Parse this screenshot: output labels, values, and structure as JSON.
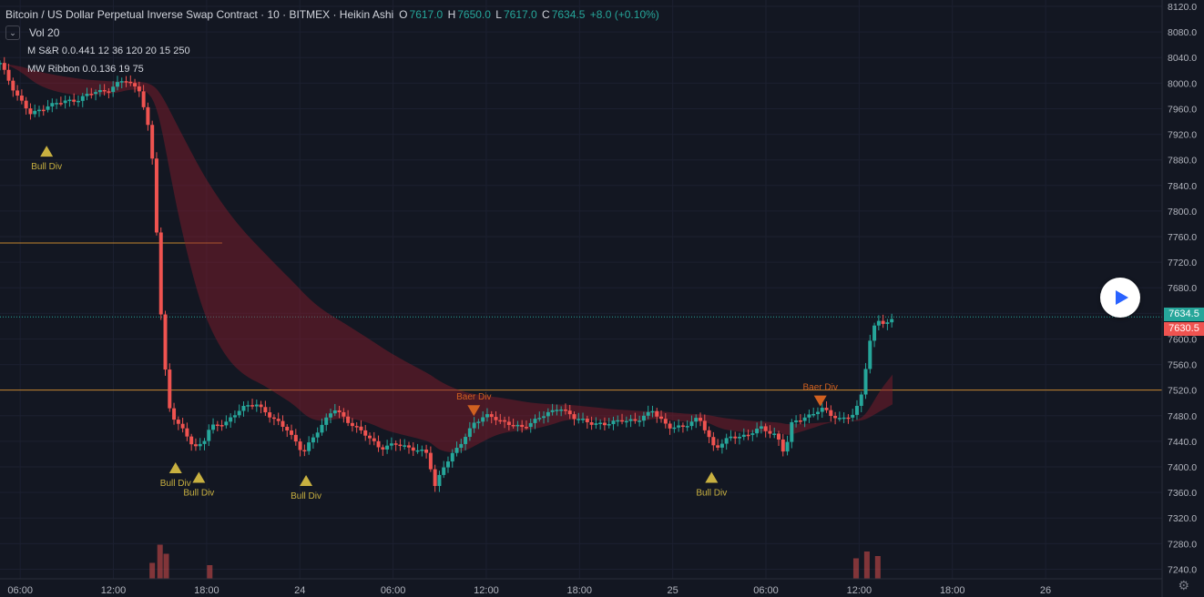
{
  "header": {
    "symbol_title": "Bitcoin / US Dollar Perpetual Inverse Swap Contract · 10 · BITMEX · Heikin Ashi",
    "o_label": "O",
    "o_value": "7617.0",
    "h_label": "H",
    "h_value": "7650.0",
    "l_label": "L",
    "l_value": "7617.0",
    "c_label": "C",
    "c_value": "7634.5",
    "change": "+8.0 (+0.10%)"
  },
  "indicators": [
    {
      "name": "Vol 20"
    },
    {
      "name": "M S&R 0.0.441 12 36 120 20 15 250"
    },
    {
      "name": "MW Ribbon 0.0.136 19 75"
    }
  ],
  "price_tags": {
    "last": "7634.5",
    "second": "7630.5"
  },
  "colors": {
    "background": "#131722",
    "up": "#26a69a",
    "down": "#ef5350",
    "last_price": "#26a69a",
    "second_price": "#ef5350",
    "level_line": "#f0a030",
    "annotation_bull": "#c8b040",
    "annotation_baer": "#d06020"
  },
  "icons": {
    "settings": "gear-icon",
    "play": "play-icon",
    "collapse": "chevron-down-icon"
  },
  "chart_data": {
    "type": "candlestick",
    "style": "Heikin Ashi",
    "y_axis": {
      "ticks": [
        "8120.0",
        "8080.0",
        "8040.0",
        "8000.0",
        "7960.0",
        "7920.0",
        "7880.0",
        "7840.0",
        "7800.0",
        "7760.0",
        "7720.0",
        "7680.0",
        "7640.0",
        "7600.0",
        "7560.0",
        "7520.0",
        "7480.0",
        "7440.0",
        "7400.0",
        "7360.0",
        "7320.0",
        "7280.0",
        "7240.0"
      ],
      "range": [
        7225,
        8130
      ]
    },
    "x_axis": {
      "ticks": [
        {
          "label": "06:00",
          "t": 0.8
        },
        {
          "label": "12:00",
          "t": 6.8
        },
        {
          "label": "18:00",
          "t": 12.8
        },
        {
          "label": "24",
          "t": 18.8
        },
        {
          "label": "06:00",
          "t": 24.8
        },
        {
          "label": "12:00",
          "t": 30.8
        },
        {
          "label": "18:00",
          "t": 36.8
        },
        {
          "label": "25",
          "t": 42.8
        },
        {
          "label": "06:00",
          "t": 48.8
        },
        {
          "label": "12:00",
          "t": 54.8
        },
        {
          "label": "18:00",
          "t": 60.8
        },
        {
          "label": "26",
          "t": 66.8
        }
      ],
      "range": [
        -0.5,
        74.3
      ]
    },
    "price_path": [
      [
        -0.5,
        8030
      ],
      [
        0.5,
        7985
      ],
      [
        1.5,
        7950
      ],
      [
        2.5,
        7965
      ],
      [
        3.5,
        7970
      ],
      [
        4.5,
        7975
      ],
      [
        5.5,
        7985
      ],
      [
        6.5,
        7990
      ],
      [
        7.5,
        8005
      ],
      [
        8.5,
        7990
      ],
      [
        9,
        7935
      ],
      [
        9.3,
        7880
      ],
      [
        9.6,
        7760
      ],
      [
        9.9,
        7620
      ],
      [
        10.1,
        7560
      ],
      [
        10.4,
        7495
      ],
      [
        10.8,
        7470
      ],
      [
        11.5,
        7450
      ],
      [
        12,
        7430
      ],
      [
        12.6,
        7440
      ],
      [
        13,
        7460
      ],
      [
        13.5,
        7465
      ],
      [
        14,
        7470
      ],
      [
        15,
        7490
      ],
      [
        16,
        7500
      ],
      [
        17,
        7475
      ],
      [
        18,
        7460
      ],
      [
        19,
        7420
      ],
      [
        20,
        7460
      ],
      [
        21,
        7490
      ],
      [
        22,
        7470
      ],
      [
        23,
        7450
      ],
      [
        24,
        7430
      ],
      [
        25,
        7435
      ],
      [
        26,
        7430
      ],
      [
        27,
        7420
      ],
      [
        27.5,
        7370
      ],
      [
        28,
        7400
      ],
      [
        29,
        7430
      ],
      [
        30,
        7470
      ],
      [
        31,
        7480
      ],
      [
        32,
        7470
      ],
      [
        33,
        7460
      ],
      [
        34,
        7475
      ],
      [
        35,
        7485
      ],
      [
        35.5,
        7495
      ],
      [
        36.5,
        7475
      ],
      [
        37.5,
        7470
      ],
      [
        38.5,
        7465
      ],
      [
        39.5,
        7475
      ],
      [
        40.5,
        7470
      ],
      [
        41.5,
        7490
      ],
      [
        42.5,
        7460
      ],
      [
        43.5,
        7465
      ],
      [
        44.5,
        7475
      ],
      [
        45.5,
        7430
      ],
      [
        46.5,
        7445
      ],
      [
        47.5,
        7450
      ],
      [
        48.5,
        7460
      ],
      [
        49.5,
        7450
      ],
      [
        50,
        7420
      ],
      [
        50.5,
        7470
      ],
      [
        51.5,
        7480
      ],
      [
        52.5,
        7490
      ],
      [
        53.5,
        7475
      ],
      [
        54.5,
        7480
      ],
      [
        55,
        7520
      ],
      [
        55.3,
        7570
      ],
      [
        55.6,
        7610
      ],
      [
        56,
        7630
      ],
      [
        56.5,
        7620
      ],
      [
        57,
        7634.5
      ]
    ],
    "volume": [
      {
        "t": 9.3,
        "v": 0.35
      },
      {
        "t": 9.8,
        "v": 0.75
      },
      {
        "t": 10.2,
        "v": 0.55
      },
      {
        "t": 13,
        "v": 0.3
      },
      {
        "t": 54.6,
        "v": 0.45
      },
      {
        "t": 55.3,
        "v": 0.6
      },
      {
        "t": 56,
        "v": 0.5
      }
    ],
    "levels": [
      {
        "price": 7750,
        "t0": -0.5,
        "t1": 13.8
      },
      {
        "price": 7520,
        "t0": -0.5,
        "t1": 74.3
      }
    ],
    "last_price": 7634.5,
    "annotations": [
      {
        "text": "Bull Div",
        "kind": "bull",
        "t": 2.5,
        "price": 7905
      },
      {
        "text": "Bull Div",
        "kind": "bull",
        "t": 10.8,
        "price": 7410
      },
      {
        "text": "Bull Div",
        "kind": "bull",
        "t": 12.3,
        "price": 7395
      },
      {
        "text": "Bull Div",
        "kind": "bull",
        "t": 19.2,
        "price": 7390
      },
      {
        "text": "Baer Div",
        "kind": "baer",
        "t": 30,
        "price": 7505
      },
      {
        "text": "Bull Div",
        "kind": "bull",
        "t": 45.3,
        "price": 7395
      },
      {
        "text": "Baer Div",
        "kind": "baer",
        "t": 52.3,
        "price": 7520
      }
    ]
  }
}
